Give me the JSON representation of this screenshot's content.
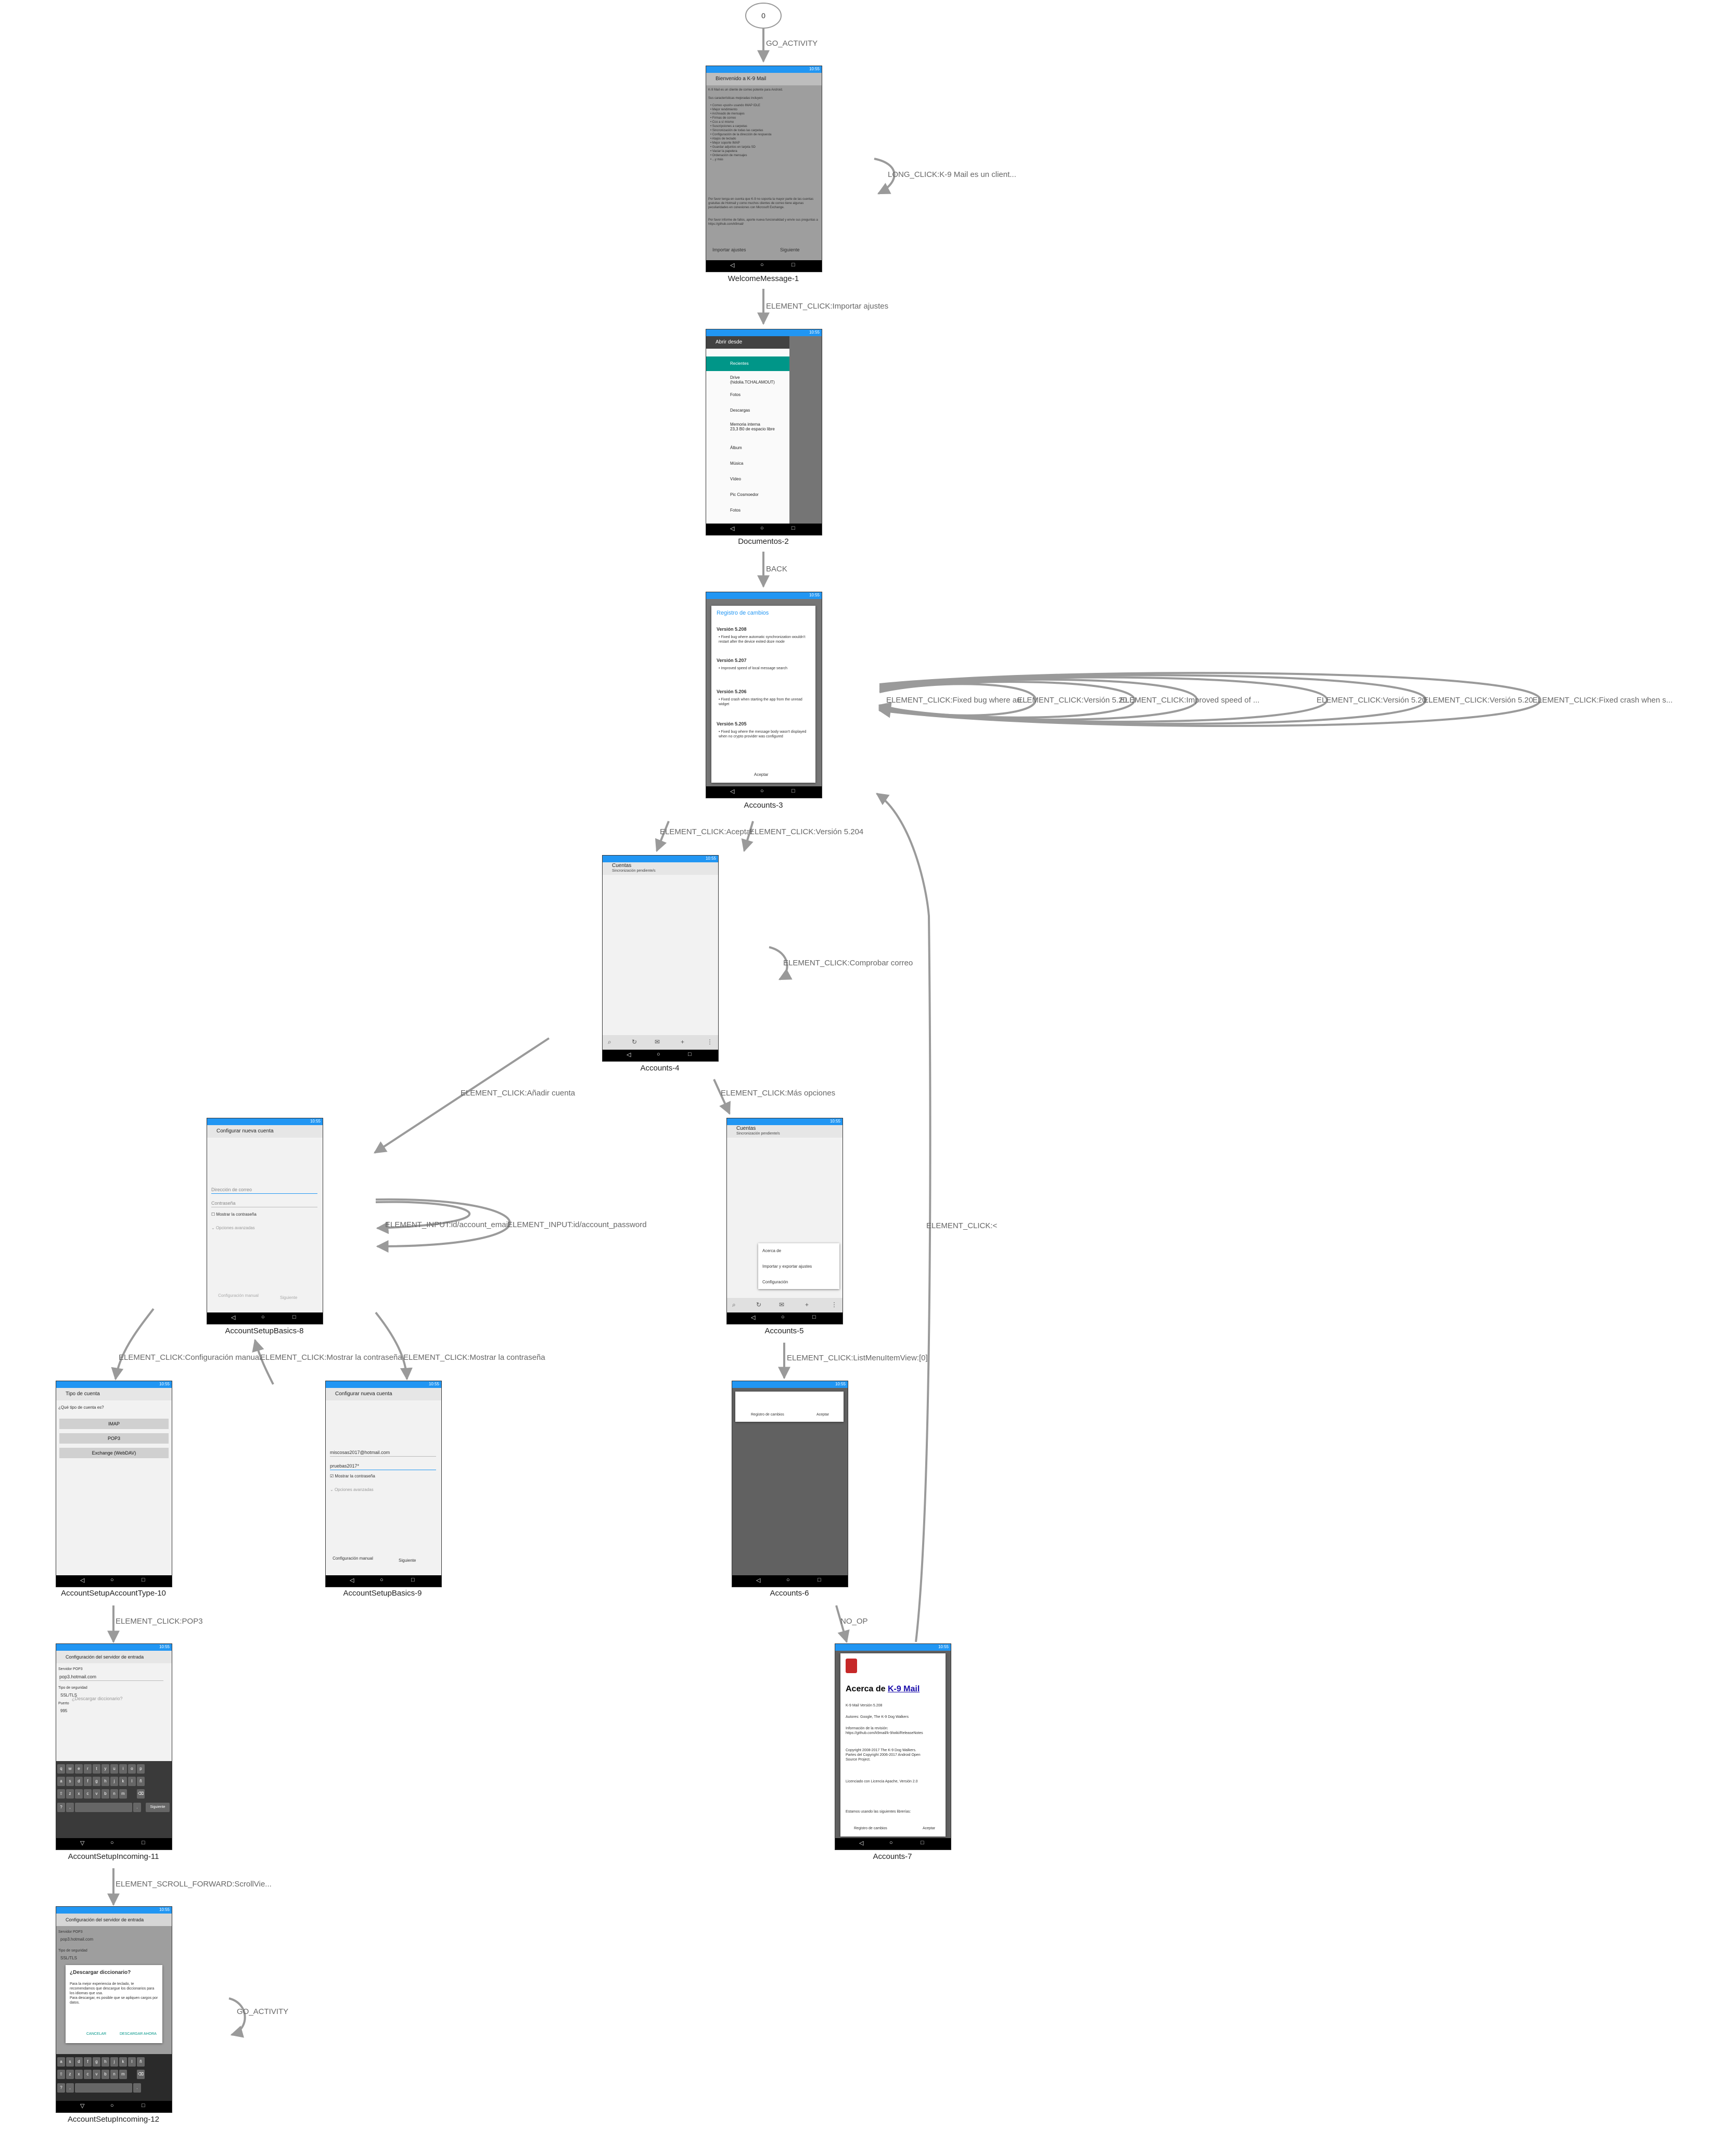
{
  "diagram": {
    "start_node": "0",
    "nodes": [
      {
        "id": "welcome",
        "label": "WelcomeMessage-1"
      },
      {
        "id": "doc2",
        "label": "Documentos-2"
      },
      {
        "id": "acc3",
        "label": "Accounts-3"
      },
      {
        "id": "acc4",
        "label": "Accounts-4"
      },
      {
        "id": "basics8",
        "label": "AccountSetupBasics-8"
      },
      {
        "id": "acc5",
        "label": "Accounts-5"
      },
      {
        "id": "type10",
        "label": "AccountSetupAccountType-10"
      },
      {
        "id": "basics9",
        "label": "AccountSetupBasics-9"
      },
      {
        "id": "acc6",
        "label": "Accounts-6"
      },
      {
        "id": "inc11",
        "label": "AccountSetupIncoming-11"
      },
      {
        "id": "acc7",
        "label": "Accounts-7"
      },
      {
        "id": "inc12",
        "label": "AccountSetupIncoming-12"
      }
    ],
    "edges": [
      {
        "label": "GO_ACTIVITY"
      },
      {
        "label": "LONG_CLICK:K-9 Mail es un client..."
      },
      {
        "label": "ELEMENT_CLICK:Importar ajustes"
      },
      {
        "label": "BACK"
      },
      {
        "label": "ELEMENT_CLICK:Fixed bug where au..."
      },
      {
        "label": "ELEMENT_CLICK:Versión 5.20..."
      },
      {
        "label": "ELEMENT_CLICK:Improved speed of ..."
      },
      {
        "label": "ELEMENT_CLICK:Versión 5.20..."
      },
      {
        "label": "ELEMENT_CLICK:Versión 5.20..."
      },
      {
        "label": "ELEMENT_CLICK:Fixed crash when s..."
      },
      {
        "label": "ELEMENT_CLICK:Aceptar"
      },
      {
        "label": "ELEMENT_CLICK:Versión 5.204"
      },
      {
        "label": "ELEMENT_CLICK:Comprobar correo"
      },
      {
        "label": "ELEMENT_CLICK:Añadir cuenta"
      },
      {
        "label": "ELEMENT_CLICK:Más opciones"
      },
      {
        "label": "ELEMENT_INPUT:id/account_email"
      },
      {
        "label": "ELEMENT_INPUT:id/account_password"
      },
      {
        "label": "ELEMENT_CLICK:Configuración manual"
      },
      {
        "label": "ELEMENT_CLICK:Mostrar la contraseña"
      },
      {
        "label": "ELEMENT_CLICK:Mostrar la contraseña"
      },
      {
        "label": "ELEMENT_CLICK:ListMenuItemView:[0]"
      },
      {
        "label": "ELEMENT_CLICK:<"
      },
      {
        "label": "ELEMENT_CLICK:POP3"
      },
      {
        "label": "NO_OP"
      },
      {
        "label": "ELEMENT_SCROLL_FORWARD:ScrollVie..."
      },
      {
        "label": "GO_ACTIVITY"
      }
    ]
  },
  "screens": {
    "status_time": "10:55",
    "welcome": {
      "title": "Bienvenido a K-9 Mail",
      "intro": "K-9 Mail es un cliente de correo potente para Android.",
      "features_heading": "Sus características mejoradas incluyen:",
      "features": "• Correo «push» usando IMAP IDLE\n• Mejor rendimiento\n• Archivado de mensajes\n• Firmas de correo\n• Cco a sí mismo\n• Suscripciones a carpetas\n• Sincronización de todas las carpetas\n• Configuración de la dirección de respuesta\n• Atajos de teclado\n• Mejor soporte IMAP\n• Guardar adjuntos en tarjeta SD\n• Vaciar la papelera\n• Ordenación de mensajes\n• ...y más",
      "body": "Por favor tenga en cuenta que K-9 no soporta la mayor parte de las cuentas gratuitas de Hotmail y como muchos clientes de correo tiene algunas peculiaridades en conexiones con Microsoft Exchange.",
      "report": "Por favor informe de fallos, aporte nueva funcionalidad y envíe sus preguntas a https://github.com/k9mail/",
      "btn_import": "Importar ajustes",
      "btn_next": "Siguiente"
    },
    "documents": {
      "title": "Abrir desde",
      "items": [
        "Recientes",
        "Drive\n(hidolia.TCHALAMOUT)",
        "Fotos",
        "Descargas",
        "Memoria interna\n23,3 B0 de espacio libre",
        "Álbum",
        "Música",
        "Vídeo",
        "Pic Cosmoedor",
        "Fotos"
      ]
    },
    "changelog": {
      "title": "Registro de cambios",
      "v208": "Versión 5.208",
      "v208_text": "• Fixed bug where automatic synchronization wouldn't restart after the device exited doze mode",
      "v207": "Versión 5.207",
      "v207_text": "• Improved speed of local message search",
      "v206": "Versión 5.206",
      "v206_text": "• Fixed crash when starting the app from the unread widget",
      "v205": "Versión 5.205",
      "v205_text": "• Fixed bug where the message body wasn't displayed when no crypto provider was configured",
      "accept": "Aceptar"
    },
    "accounts": {
      "title": "Cuentas",
      "subtitle": "Sincronización pendiente/s",
      "menu": [
        "Acerca de",
        "Importar y exportar ajustes",
        "Configuración"
      ]
    },
    "setup": {
      "title": "Configurar nueva cuenta",
      "email_hint": "Dirección de correo",
      "password_hint": "Contraseña",
      "show_password": "Mostrar la contraseña",
      "advanced": "Opciones avanzadas",
      "manual": "Configuración manual",
      "next": "Siguiente",
      "email_value": "miscosas2017@hotmail.com",
      "password_value": "pruebas2017*"
    },
    "account_type": {
      "title": "Tipo de cuenta",
      "question": "¿Qué tipo de cuenta es?",
      "options": [
        "IMAP",
        "POP3",
        "Exchange (WebDAV)"
      ]
    },
    "incoming": {
      "title": "Configuración del servidor de entrada",
      "server_label": "Servidor POP3",
      "server_value": "pop3.hotmail.com",
      "security_label": "Tipo de seguridad",
      "security_value": "SSL/TLS",
      "port_label": "Puerto",
      "port_value": "995",
      "dict_title": "¿Descargar diccionario?",
      "dict_text": "Para la mejor experiencia de teclado, te recomendamos que descargue los diccionarios para los idiomas que usa.\nPara descargar, es posible que se apliquen cargos por datos.",
      "dict_cancel": "CANCELAR",
      "dict_download": "DESCARGAR AHORA",
      "next_key": "Siguiente"
    },
    "changelog_small": {
      "changelog_btn": "Registro de cambios",
      "accept": "Aceptar"
    },
    "about": {
      "title_prefix": "Acerca de ",
      "title_link": "K-9 Mail",
      "version": "K-9 Mail Versión 5.208",
      "authors": "Autores: Google, The K-9 Dog Walkers",
      "info": "Información de la revisión:\nhttps://github.com/k9mail/k-9/wiki/ReleaseNotes",
      "copyright": "Copyright 2008-2017 The K-9 Dog Walkers. Partes del Copyright 2006-2017 Android Open Source Project.",
      "license": "Licenciado con Licencia Apache, Versión 2.0",
      "uses": "Estamos usando las siguientes librerías:",
      "changelog_btn": "Registro de cambios",
      "accept": "Aceptar"
    }
  }
}
